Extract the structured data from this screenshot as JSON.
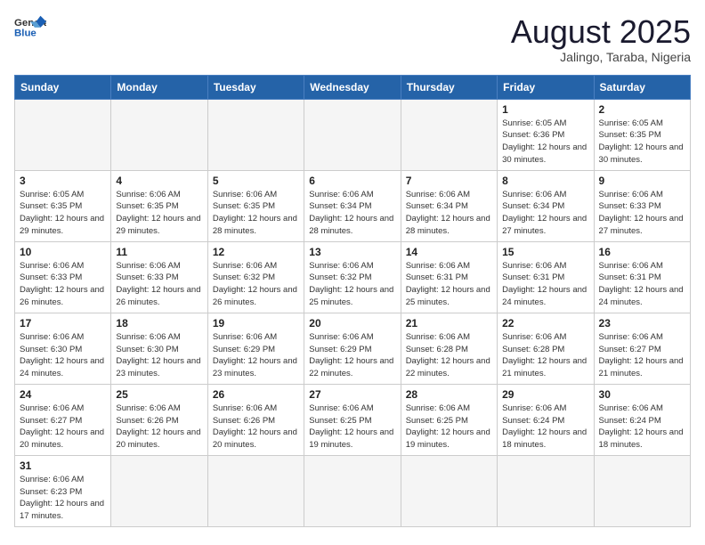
{
  "header": {
    "logo_general": "General",
    "logo_blue": "Blue",
    "month_title": "August 2025",
    "subtitle": "Jalingo, Taraba, Nigeria"
  },
  "days_of_week": [
    "Sunday",
    "Monday",
    "Tuesday",
    "Wednesday",
    "Thursday",
    "Friday",
    "Saturday"
  ],
  "weeks": [
    [
      {
        "day": "",
        "info": "",
        "empty": true
      },
      {
        "day": "",
        "info": "",
        "empty": true
      },
      {
        "day": "",
        "info": "",
        "empty": true
      },
      {
        "day": "",
        "info": "",
        "empty": true
      },
      {
        "day": "",
        "info": "",
        "empty": true
      },
      {
        "day": "1",
        "info": "Sunrise: 6:05 AM\nSunset: 6:36 PM\nDaylight: 12 hours\nand 30 minutes."
      },
      {
        "day": "2",
        "info": "Sunrise: 6:05 AM\nSunset: 6:35 PM\nDaylight: 12 hours\nand 30 minutes."
      }
    ],
    [
      {
        "day": "3",
        "info": "Sunrise: 6:05 AM\nSunset: 6:35 PM\nDaylight: 12 hours\nand 29 minutes."
      },
      {
        "day": "4",
        "info": "Sunrise: 6:06 AM\nSunset: 6:35 PM\nDaylight: 12 hours\nand 29 minutes."
      },
      {
        "day": "5",
        "info": "Sunrise: 6:06 AM\nSunset: 6:35 PM\nDaylight: 12 hours\nand 28 minutes."
      },
      {
        "day": "6",
        "info": "Sunrise: 6:06 AM\nSunset: 6:34 PM\nDaylight: 12 hours\nand 28 minutes."
      },
      {
        "day": "7",
        "info": "Sunrise: 6:06 AM\nSunset: 6:34 PM\nDaylight: 12 hours\nand 28 minutes."
      },
      {
        "day": "8",
        "info": "Sunrise: 6:06 AM\nSunset: 6:34 PM\nDaylight: 12 hours\nand 27 minutes."
      },
      {
        "day": "9",
        "info": "Sunrise: 6:06 AM\nSunset: 6:33 PM\nDaylight: 12 hours\nand 27 minutes."
      }
    ],
    [
      {
        "day": "10",
        "info": "Sunrise: 6:06 AM\nSunset: 6:33 PM\nDaylight: 12 hours\nand 26 minutes."
      },
      {
        "day": "11",
        "info": "Sunrise: 6:06 AM\nSunset: 6:33 PM\nDaylight: 12 hours\nand 26 minutes."
      },
      {
        "day": "12",
        "info": "Sunrise: 6:06 AM\nSunset: 6:32 PM\nDaylight: 12 hours\nand 26 minutes."
      },
      {
        "day": "13",
        "info": "Sunrise: 6:06 AM\nSunset: 6:32 PM\nDaylight: 12 hours\nand 25 minutes."
      },
      {
        "day": "14",
        "info": "Sunrise: 6:06 AM\nSunset: 6:31 PM\nDaylight: 12 hours\nand 25 minutes."
      },
      {
        "day": "15",
        "info": "Sunrise: 6:06 AM\nSunset: 6:31 PM\nDaylight: 12 hours\nand 24 minutes."
      },
      {
        "day": "16",
        "info": "Sunrise: 6:06 AM\nSunset: 6:31 PM\nDaylight: 12 hours\nand 24 minutes."
      }
    ],
    [
      {
        "day": "17",
        "info": "Sunrise: 6:06 AM\nSunset: 6:30 PM\nDaylight: 12 hours\nand 24 minutes."
      },
      {
        "day": "18",
        "info": "Sunrise: 6:06 AM\nSunset: 6:30 PM\nDaylight: 12 hours\nand 23 minutes."
      },
      {
        "day": "19",
        "info": "Sunrise: 6:06 AM\nSunset: 6:29 PM\nDaylight: 12 hours\nand 23 minutes."
      },
      {
        "day": "20",
        "info": "Sunrise: 6:06 AM\nSunset: 6:29 PM\nDaylight: 12 hours\nand 22 minutes."
      },
      {
        "day": "21",
        "info": "Sunrise: 6:06 AM\nSunset: 6:28 PM\nDaylight: 12 hours\nand 22 minutes."
      },
      {
        "day": "22",
        "info": "Sunrise: 6:06 AM\nSunset: 6:28 PM\nDaylight: 12 hours\nand 21 minutes."
      },
      {
        "day": "23",
        "info": "Sunrise: 6:06 AM\nSunset: 6:27 PM\nDaylight: 12 hours\nand 21 minutes."
      }
    ],
    [
      {
        "day": "24",
        "info": "Sunrise: 6:06 AM\nSunset: 6:27 PM\nDaylight: 12 hours\nand 20 minutes."
      },
      {
        "day": "25",
        "info": "Sunrise: 6:06 AM\nSunset: 6:26 PM\nDaylight: 12 hours\nand 20 minutes."
      },
      {
        "day": "26",
        "info": "Sunrise: 6:06 AM\nSunset: 6:26 PM\nDaylight: 12 hours\nand 20 minutes."
      },
      {
        "day": "27",
        "info": "Sunrise: 6:06 AM\nSunset: 6:25 PM\nDaylight: 12 hours\nand 19 minutes."
      },
      {
        "day": "28",
        "info": "Sunrise: 6:06 AM\nSunset: 6:25 PM\nDaylight: 12 hours\nand 19 minutes."
      },
      {
        "day": "29",
        "info": "Sunrise: 6:06 AM\nSunset: 6:24 PM\nDaylight: 12 hours\nand 18 minutes."
      },
      {
        "day": "30",
        "info": "Sunrise: 6:06 AM\nSunset: 6:24 PM\nDaylight: 12 hours\nand 18 minutes."
      }
    ],
    [
      {
        "day": "31",
        "info": "Sunrise: 6:06 AM\nSunset: 6:23 PM\nDaylight: 12 hours\nand 17 minutes."
      },
      {
        "day": "",
        "info": "",
        "empty": true
      },
      {
        "day": "",
        "info": "",
        "empty": true
      },
      {
        "day": "",
        "info": "",
        "empty": true
      },
      {
        "day": "",
        "info": "",
        "empty": true
      },
      {
        "day": "",
        "info": "",
        "empty": true
      },
      {
        "day": "",
        "info": "",
        "empty": true
      }
    ]
  ]
}
